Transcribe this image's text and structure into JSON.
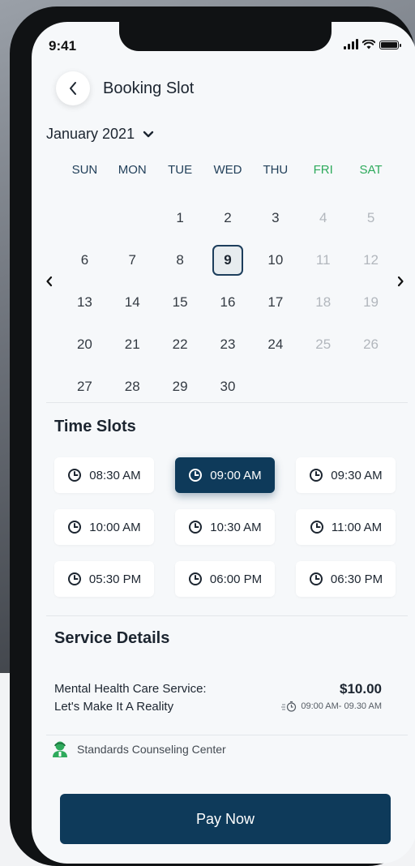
{
  "status_bar": {
    "time": "9:41"
  },
  "header": {
    "title": "Booking Slot"
  },
  "calendar": {
    "month_label": "January 2021",
    "weekdays": [
      {
        "label": "SUN",
        "weekend": false
      },
      {
        "label": "MON",
        "weekend": false
      },
      {
        "label": "TUE",
        "weekend": false
      },
      {
        "label": "WED",
        "weekend": false
      },
      {
        "label": "THU",
        "weekend": false
      },
      {
        "label": "FRI",
        "weekend": true
      },
      {
        "label": "SAT",
        "weekend": true
      }
    ],
    "leading_blanks": 2,
    "days": [
      {
        "n": "1",
        "muted": false
      },
      {
        "n": "2",
        "muted": false
      },
      {
        "n": "3",
        "muted": false
      },
      {
        "n": "4",
        "muted": true
      },
      {
        "n": "5",
        "muted": true
      },
      {
        "n": "6",
        "muted": false
      },
      {
        "n": "7",
        "muted": false
      },
      {
        "n": "8",
        "muted": false
      },
      {
        "n": "9",
        "muted": false,
        "selected": true
      },
      {
        "n": "10",
        "muted": false
      },
      {
        "n": "11",
        "muted": true
      },
      {
        "n": "12",
        "muted": true
      },
      {
        "n": "13",
        "muted": false
      },
      {
        "n": "14",
        "muted": false
      },
      {
        "n": "15",
        "muted": false
      },
      {
        "n": "16",
        "muted": false
      },
      {
        "n": "17",
        "muted": false
      },
      {
        "n": "18",
        "muted": true
      },
      {
        "n": "19",
        "muted": true
      },
      {
        "n": "20",
        "muted": false
      },
      {
        "n": "21",
        "muted": false
      },
      {
        "n": "22",
        "muted": false
      },
      {
        "n": "23",
        "muted": false
      },
      {
        "n": "24",
        "muted": false
      },
      {
        "n": "25",
        "muted": true
      },
      {
        "n": "26",
        "muted": true
      },
      {
        "n": "27",
        "muted": false
      },
      {
        "n": "28",
        "muted": false
      },
      {
        "n": "29",
        "muted": false
      },
      {
        "n": "30",
        "muted": false
      }
    ]
  },
  "time_slots": {
    "title": "Time Slots",
    "slots": [
      {
        "label": "08:30 AM",
        "active": false
      },
      {
        "label": "09:00 AM",
        "active": true
      },
      {
        "label": "09:30 AM",
        "active": false
      },
      {
        "label": "10:00 AM",
        "active": false
      },
      {
        "label": "10:30 AM",
        "active": false
      },
      {
        "label": "11:00 AM",
        "active": false
      },
      {
        "label": "05:30 PM",
        "active": false
      },
      {
        "label": "06:00 PM",
        "active": false
      },
      {
        "label": "06:30 PM",
        "active": false
      }
    ]
  },
  "service": {
    "title": "Service Details",
    "name_line1": "Mental Health Care Service:",
    "name_line2": "Let's Make It  A Reality",
    "price": "$10.00",
    "time_range": "09:00 AM- 09.30 AM",
    "provider": "Standards Counseling Center"
  },
  "actions": {
    "pay_label": "Pay Now"
  },
  "colors": {
    "primary": "#0e3a5a",
    "weekend": "#2eaa5c",
    "muted_day": "#b2b7bd",
    "screen_bg": "#f6f8fa"
  }
}
